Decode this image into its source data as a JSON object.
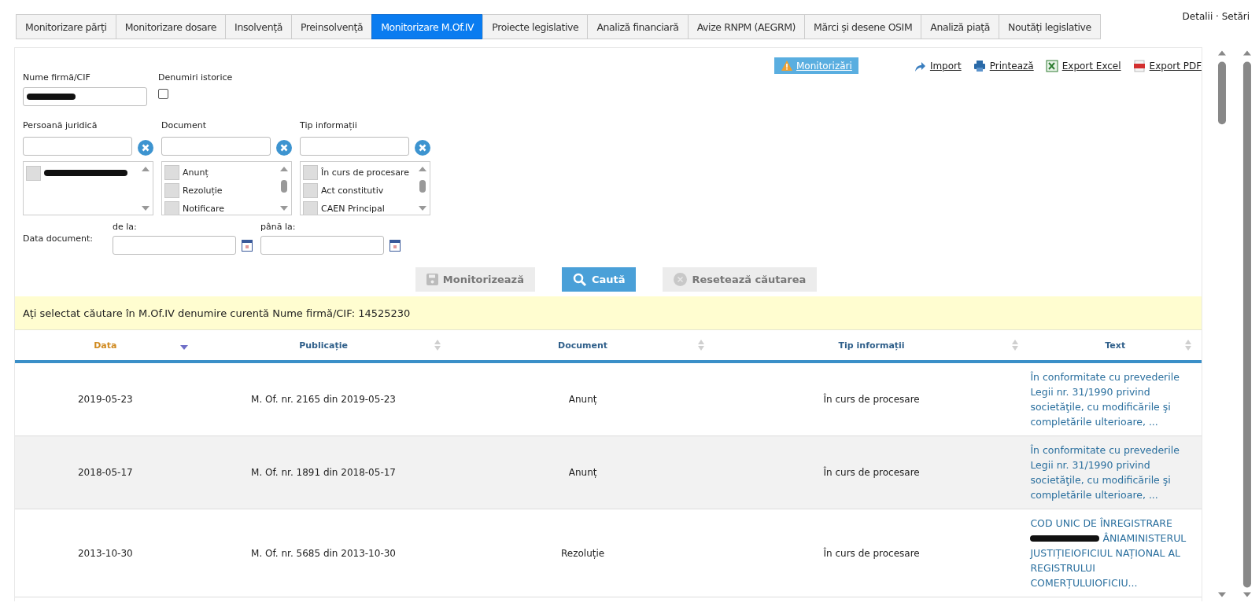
{
  "tabs": [
    {
      "label": "Monitorizare părți",
      "selected": false
    },
    {
      "label": "Monitorizare dosare",
      "selected": false
    },
    {
      "label": "Insolvență",
      "selected": false
    },
    {
      "label": "Preinsolvență",
      "selected": false
    },
    {
      "label": "Monitorizare M.Of.IV",
      "selected": true
    },
    {
      "label": "Proiecte legislative",
      "selected": false
    },
    {
      "label": "Analiză financiară",
      "selected": false
    },
    {
      "label": "Avize RNPM (AEGRM)",
      "selected": false
    },
    {
      "label": "Mărci și desene OSIM",
      "selected": false
    },
    {
      "label": "Analiză piață",
      "selected": false
    },
    {
      "label": "Noutăți legislative",
      "selected": false
    }
  ],
  "top_right_link": "Detalii · Setări",
  "monitorizari_button": "Monitorizări",
  "actions": [
    {
      "kind": "import",
      "label": "Import"
    },
    {
      "kind": "print",
      "label": "Printează"
    },
    {
      "kind": "excel",
      "label": "Export Excel"
    },
    {
      "kind": "pdf",
      "label": "Export PDF"
    }
  ],
  "firm_field": {
    "label": "Nume firmă/CIF",
    "redacted": true
  },
  "historic_names": {
    "label": "Denumiri istorice",
    "checked": false
  },
  "filters": [
    {
      "label": "Persoană juridică",
      "items": [
        {
          "redacted": true,
          "checked": false
        }
      ]
    },
    {
      "label": "Document",
      "items": [
        {
          "label": "Anunț",
          "checked": false
        },
        {
          "label": "Rezoluție",
          "checked": false
        },
        {
          "label": "Notificare",
          "checked": false
        }
      ]
    },
    {
      "label": "Tip informații",
      "items": [
        {
          "label": "În curs de procesare",
          "checked": false
        },
        {
          "label": "Act constitutiv",
          "checked": false
        },
        {
          "label": "CAEN Principal",
          "checked": false
        }
      ]
    }
  ],
  "date_filter": {
    "label": "Data document:",
    "from_label": "de la:",
    "to_label": "până la:"
  },
  "buttons": [
    {
      "kind": "save",
      "label": "Monitorizează",
      "disabled": true
    },
    {
      "kind": "search",
      "label": "Caută",
      "disabled": false
    },
    {
      "kind": "reset",
      "label": "Resetează căutarea",
      "disabled": true
    }
  ],
  "notice": "Ați selectat căutare în M.Of.IV denumire curentă Nume firmă/CIF: 14525230",
  "table": {
    "columns": [
      {
        "label": "Data",
        "sorted": true
      },
      {
        "label": "Publicație",
        "sorted": false
      },
      {
        "label": "Document",
        "sorted": false
      },
      {
        "label": "Tip informații",
        "sorted": false
      },
      {
        "label": "Text",
        "sorted": false
      }
    ],
    "rows": [
      {
        "date": "2019-05-23",
        "publication": "M. Of. nr. 2165 din 2019-05-23",
        "document": "Anunț",
        "info_type": "În curs de procesare",
        "text": "În conformitate cu prevederile Legii nr. 31/1990 privind societăţile, cu modificările şi completările ulterioare, ..."
      },
      {
        "date": "2018-05-17",
        "publication": "M. Of. nr. 1891 din 2018-05-17",
        "document": "Anunț",
        "info_type": "În curs de procesare",
        "text": "În conformitate cu prevederile Legii nr. 31/1990 privind societăţile, cu modificările şi completările ulterioare, ..."
      },
      {
        "date": "2013-10-30",
        "publication": "M. Of. nr. 5685 din 2013-10-30",
        "document": "Rezoluție",
        "info_type": "În curs de procesare",
        "text_before_redaction": "COD UNIC DE ÎNREGISTRARE",
        "redacted": true,
        "text": "ÂNIAMINISTERUL JUSTIȚIEIOFICIUL NAȚIONAL AL REGISTRULUI COMERȚULUIOFICIU..."
      }
    ]
  }
}
